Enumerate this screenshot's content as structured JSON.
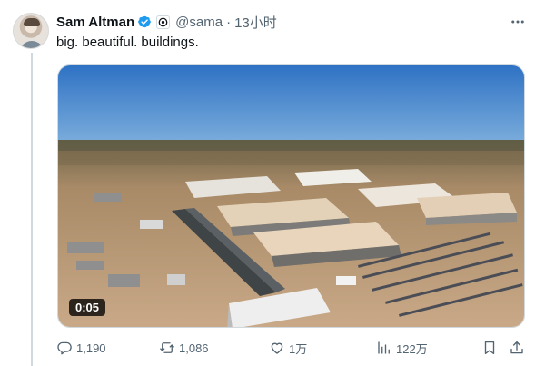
{
  "tweet": {
    "author": {
      "name": "Sam Altman",
      "handle": "@sama",
      "verified_color": "#1d9bf0",
      "avatar_icon": "profile-photo"
    },
    "separator": "·",
    "time": "13小时",
    "text": "big. beautiful. buildings.",
    "media": {
      "type": "video",
      "duration": "0:05"
    },
    "actions": {
      "reply_count": "1,190",
      "retweet_count": "1,086",
      "like_count": "1万",
      "views_count": "122万"
    }
  },
  "colors": {
    "text_primary": "#0f1419",
    "text_secondary": "#536471",
    "border": "#cfd9de",
    "verified": "#1d9bf0"
  }
}
